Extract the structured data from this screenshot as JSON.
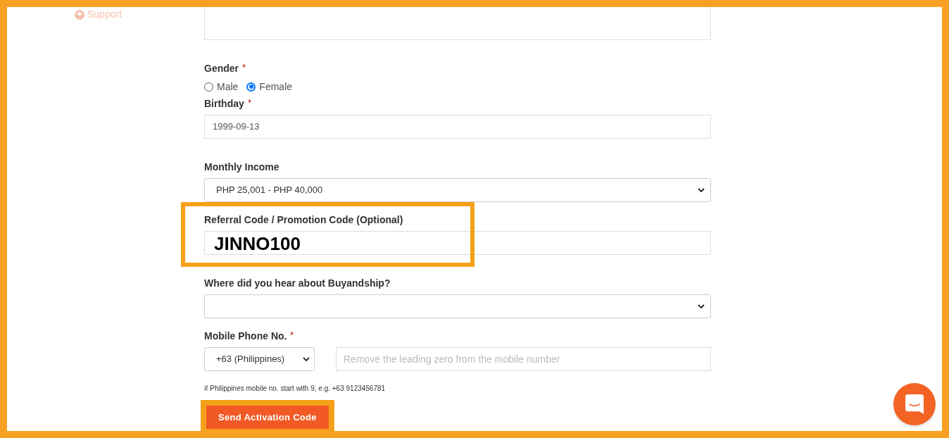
{
  "support_link": {
    "label": "Support"
  },
  "fields": [
    {
      "kind": "textarea"
    },
    {
      "kind": "radio",
      "label": "Gender",
      "required": true,
      "options": [
        {
          "label": "Male",
          "selected": false
        },
        {
          "label": "Female",
          "selected": true
        }
      ]
    },
    {
      "kind": "text",
      "label": "Birthday",
      "required": true,
      "value": "1999-09-13"
    },
    {
      "kind": "select",
      "label": "Monthly Income",
      "required": false,
      "value": "PHP 25,001 - PHP 40,000"
    },
    {
      "kind": "text",
      "label": "Referral Code / Promotion Code (Optional)",
      "required": false,
      "value": "JINNO100",
      "highlighted": true
    },
    {
      "kind": "select",
      "label": "Where did you hear about Buyandship?",
      "required": false
    },
    {
      "kind": "phone",
      "label": "Mobile Phone No.",
      "required": true,
      "country": "+63 (Philippines)",
      "placeholder": "Remove the leading zero from the mobile number",
      "hint": "# Philippines mobile no. start with 9, e.g. +63 9123456781"
    }
  ],
  "submit_button": {
    "label": "Send Activation Code",
    "highlighted": true
  }
}
